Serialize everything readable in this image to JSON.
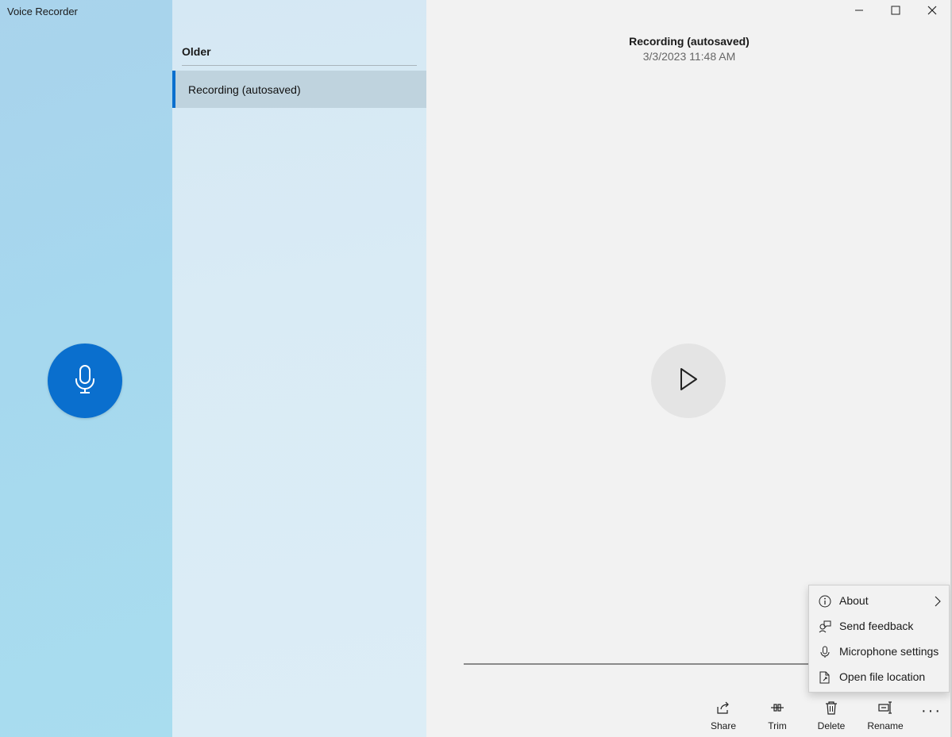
{
  "app": {
    "title": "Voice Recorder"
  },
  "list": {
    "group_header": "Older",
    "items": [
      {
        "label": "Recording (autosaved)"
      }
    ]
  },
  "recording": {
    "title": "Recording (autosaved)",
    "date": "3/3/2023 11:48 AM"
  },
  "toolbar": {
    "share": "Share",
    "trim": "Trim",
    "delete": "Delete",
    "rename": "Rename",
    "more": "···"
  },
  "menu": {
    "items": [
      {
        "label": "About",
        "icon": "info-icon"
      },
      {
        "label": "Send feedback",
        "icon": "feedback-icon"
      },
      {
        "label": "Microphone settings",
        "icon": "microphone-icon"
      },
      {
        "label": "Open file location",
        "icon": "file-icon"
      }
    ]
  },
  "colors": {
    "accent": "#0a6fce",
    "left_pane": "#a9d8ee",
    "list_pane": "#d8eaf5",
    "main_bg": "#f2f2f2"
  }
}
